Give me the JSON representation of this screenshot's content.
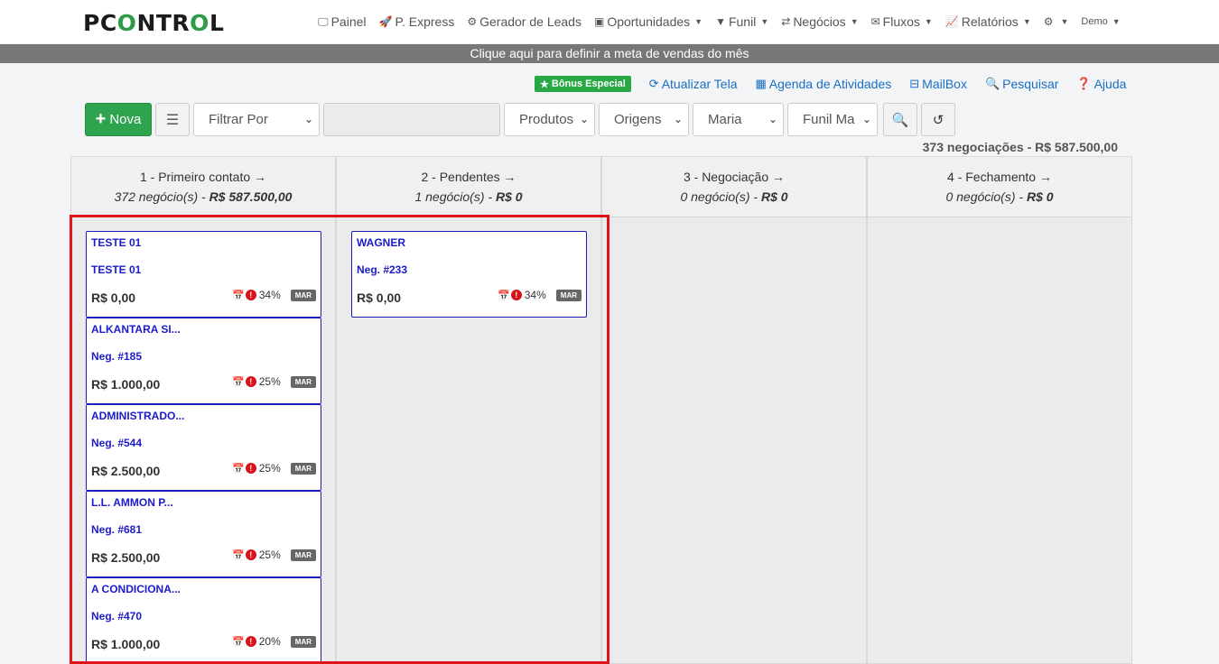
{
  "brand": {
    "logo_text": "PCONTROL"
  },
  "nav": {
    "items": [
      {
        "label": "Painel",
        "icon": "monitor-icon"
      },
      {
        "label": "P. Express",
        "icon": "rocket-icon"
      },
      {
        "label": "Gerador de Leads",
        "icon": "robot-icon"
      },
      {
        "label": "Oportunidades",
        "icon": "contact-card-icon"
      },
      {
        "label": "Funil",
        "icon": "filter-icon"
      },
      {
        "label": "Negócios",
        "icon": "handshake-icon"
      },
      {
        "label": "Fluxos",
        "icon": "envelope-icon"
      },
      {
        "label": "Relatórios",
        "icon": "chart-line-icon"
      },
      {
        "label": "",
        "icon": "gear-icon"
      },
      {
        "label": "Demo",
        "icon": ""
      }
    ]
  },
  "goal_bar": {
    "text": "Clique aqui para definir a meta de vendas do mês"
  },
  "actions": {
    "bonus": "Bônus Especial",
    "refresh": "Atualizar Tela",
    "agenda": "Agenda de Atividades",
    "mailbox": "MailBox",
    "search": "Pesquisar",
    "help": "Ajuda"
  },
  "filters": {
    "new_button": "Nova",
    "filter_by": "Filtrar Por",
    "products": "Produtos",
    "origins": "Origens",
    "user": "Maria",
    "funnel": "Funil Ma"
  },
  "summary": "373 negociações - R$ 587.500,00",
  "colors": {
    "accent_green": "#2ea44f",
    "link_blue": "#1a6fc4",
    "card_border": "#1b1bb5",
    "alert_red": "#d9121a",
    "highlight_red": "#e0141b"
  },
  "columns": [
    {
      "title": "1 - Primeiro contato →",
      "count": "372 negócio(s) - ",
      "total": "R$ 587.500,00",
      "cards": [
        {
          "name": "TESTE 01",
          "sub": "TESTE 01",
          "value": "R$ 0,00",
          "pct": "34%",
          "tag": "MAR"
        },
        {
          "name": "ALKANTARA SI...",
          "sub": "Neg. #185",
          "value": "R$ 1.000,00",
          "pct": "25%",
          "tag": "MAR"
        },
        {
          "name": "ADMINISTRADO...",
          "sub": "Neg. #544",
          "value": "R$ 2.500,00",
          "pct": "25%",
          "tag": "MAR"
        },
        {
          "name": "L.L. AMMON P...",
          "sub": "Neg. #681",
          "value": "R$ 2.500,00",
          "pct": "25%",
          "tag": "MAR"
        },
        {
          "name": "A CONDICIONA...",
          "sub": "Neg. #470",
          "value": "R$ 1.000,00",
          "pct": "20%",
          "tag": "MAR"
        }
      ]
    },
    {
      "title": "2 - Pendentes →",
      "count": "1 negócio(s) - ",
      "total": "R$ 0",
      "cards": [
        {
          "name": "WAGNER",
          "sub": "Neg. #233",
          "value": "R$ 0,00",
          "pct": "34%",
          "tag": "MAR"
        }
      ]
    },
    {
      "title": "3 - Negociação →",
      "count": "0 negócio(s) - ",
      "total": "R$ 0",
      "cards": []
    },
    {
      "title": "4 - Fechamento →",
      "count": "0 negócio(s) - ",
      "total": "R$ 0",
      "cards": []
    }
  ]
}
